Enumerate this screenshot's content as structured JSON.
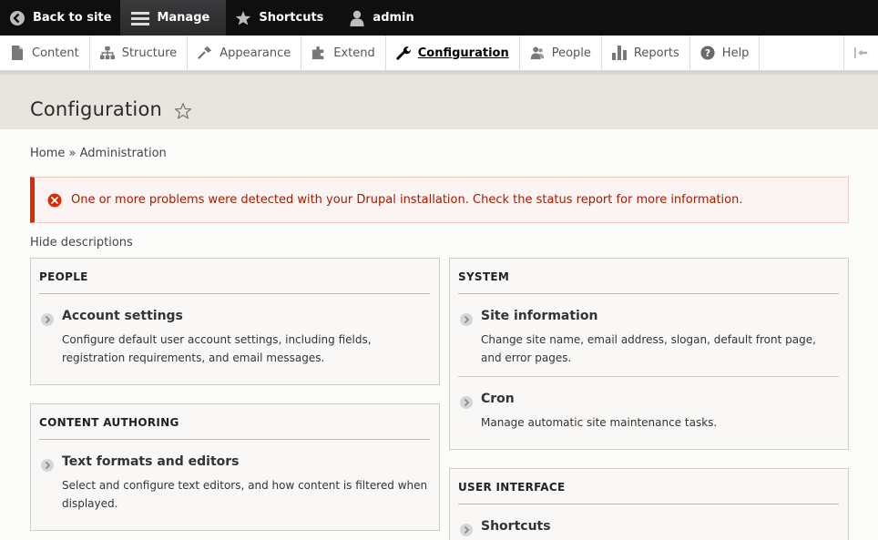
{
  "toolbar": {
    "back_label": "Back to site",
    "manage_label": "Manage",
    "shortcuts_label": "Shortcuts",
    "user_label": "admin"
  },
  "tray": {
    "items": [
      {
        "label": "Content",
        "icon": "content-icon"
      },
      {
        "label": "Structure",
        "icon": "structure-icon"
      },
      {
        "label": "Appearance",
        "icon": "appearance-icon"
      },
      {
        "label": "Extend",
        "icon": "extend-icon"
      },
      {
        "label": "Configuration",
        "icon": "wrench-icon",
        "active": true
      },
      {
        "label": "People",
        "icon": "people-icon"
      },
      {
        "label": "Reports",
        "icon": "reports-icon"
      },
      {
        "label": "Help",
        "icon": "help-icon"
      }
    ]
  },
  "page": {
    "title": "Configuration",
    "breadcrumb_home": "Home",
    "breadcrumb_sep": "»",
    "breadcrumb_admin": "Administration",
    "alert": "One or more problems were detected with your Drupal installation. Check the status report for more information.",
    "hide_descriptions": "Hide descriptions"
  },
  "panels": {
    "people": {
      "title": "PEOPLE",
      "entries": [
        {
          "title": "Account settings",
          "desc": "Configure default user account settings, including fields, registration requirements, and email messages."
        }
      ]
    },
    "content_authoring": {
      "title": "CONTENT AUTHORING",
      "entries": [
        {
          "title": "Text formats and editors",
          "desc": "Select and configure text editors, and how content is filtered when displayed."
        }
      ]
    },
    "system": {
      "title": "SYSTEM",
      "entries": [
        {
          "title": "Site information",
          "desc": "Change site name, email address, slogan, default front page, and error pages."
        },
        {
          "title": "Cron",
          "desc": "Manage automatic site maintenance tasks."
        }
      ]
    },
    "user_interface": {
      "title": "USER INTERFACE",
      "entries": [
        {
          "title": "Shortcuts",
          "desc": ""
        }
      ]
    }
  },
  "colors": {
    "toolbar_bg": "#0f0f0f",
    "alert_border": "#e32700",
    "alert_text": "#a51b00",
    "header_bg": "#e7e5de"
  }
}
